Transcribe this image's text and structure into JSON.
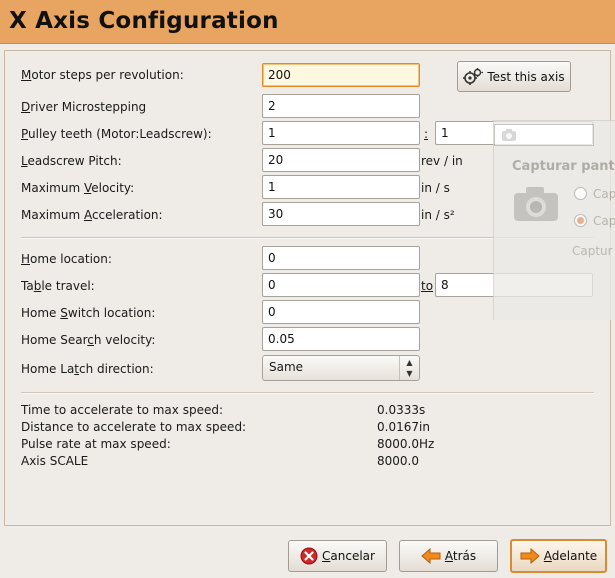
{
  "header": {
    "title": "X Axis Configuration"
  },
  "fields": {
    "motor_steps": {
      "label": "Motor steps per revolution:",
      "ul": "M",
      "rest": "otor steps per revolution:",
      "value": "200"
    },
    "microstepping": {
      "ul": "D",
      "rest": "river Microstepping",
      "value": "2"
    },
    "pulley": {
      "ul": "P",
      "rest": "ulley teeth (Motor:Leadscrew):",
      "value_motor": "1",
      "sep": ":",
      "value_lead": "1"
    },
    "pitch": {
      "ul": "L",
      "rest": "eadscrew Pitch:",
      "value": "20",
      "unit": "rev / in"
    },
    "velocity": {
      "pre": "Maximum ",
      "ul": "V",
      "rest": "elocity:",
      "value": "1",
      "unit": "in / s"
    },
    "acceleration": {
      "pre": "Maximum ",
      "ul": "A",
      "rest": "cceleration:",
      "value": "30",
      "unit": "in / s²"
    },
    "home_location": {
      "ul": "H",
      "rest": "ome location:",
      "value": "0"
    },
    "table_travel": {
      "pre": "Ta",
      "ul": "b",
      "rest": "le travel:",
      "value_from": "0",
      "to": "to",
      "value_to": "8"
    },
    "home_switch": {
      "pre": "Home ",
      "ul": "S",
      "rest": "witch location:",
      "value": "0"
    },
    "home_search": {
      "pre": "Home Sear",
      "ul": "c",
      "rest": "h velocity:",
      "value": "0.05"
    },
    "home_latch": {
      "pre": "Home La",
      "ul": "t",
      "rest": "ch direction:",
      "value": "Same"
    }
  },
  "test_button": {
    "label": "Test this axis"
  },
  "info": [
    {
      "label": "Time to accelerate to max speed:",
      "value": "0.0333s"
    },
    {
      "label": "Distance to accelerate to max speed:",
      "value": "0.0167in"
    },
    {
      "label": "Pulse rate at max speed:",
      "value": "8000.0Hz"
    },
    {
      "label": "Axis SCALE",
      "value": "8000.0"
    }
  ],
  "buttons": {
    "cancel": {
      "ul": "C",
      "rest": "ancelar"
    },
    "back": {
      "ul": "A",
      "rest": "trás"
    },
    "forward": {
      "ul": "A",
      "rest": "delante"
    }
  },
  "overlay": {
    "title": "Capturar pant",
    "radio1": "Cap",
    "radio2": "Cap",
    "sub": "Captur"
  },
  "colors": {
    "header": "#e8a562",
    "focus": "#e08a2a",
    "cancel_icon": "#d0282a",
    "arrow_icon": "#f08a1c"
  }
}
